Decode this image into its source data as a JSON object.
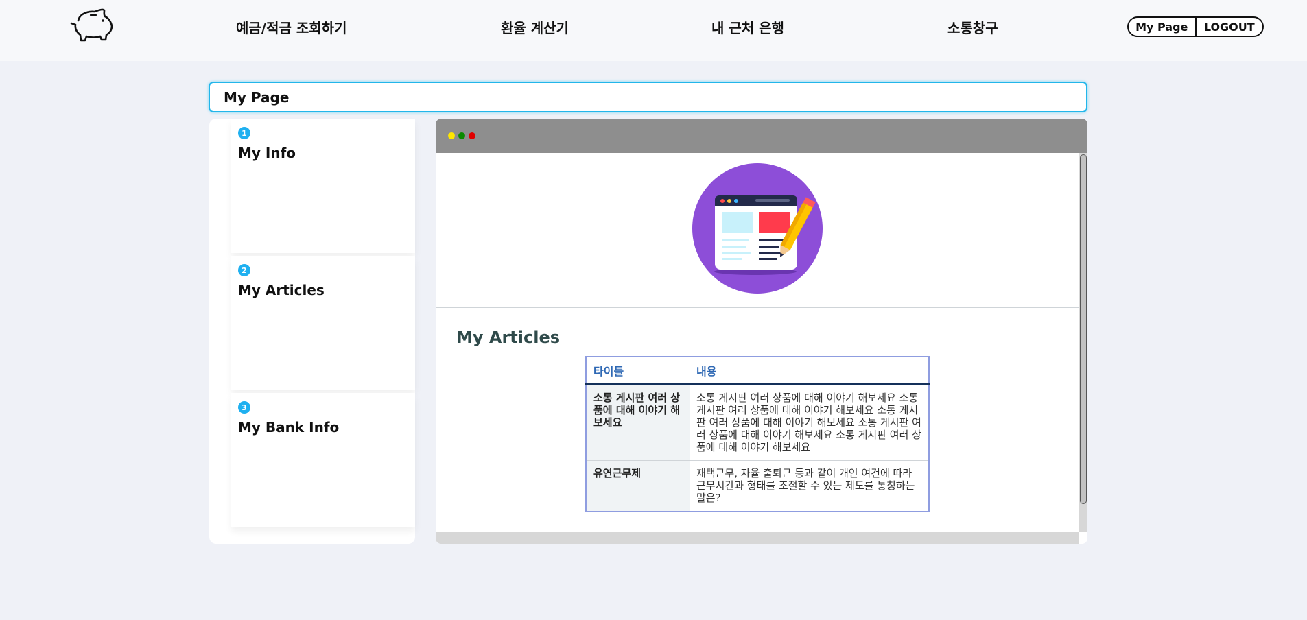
{
  "header": {
    "nav": [
      "예금/적금 조회하기",
      "환율 계산기",
      "내 근처 은행",
      "소통창구"
    ],
    "mypage_label": "My Page",
    "logout_label": "LOGOUT"
  },
  "page": {
    "title": "My Page"
  },
  "sidebar": {
    "items": [
      {
        "num": "1",
        "label": "My Info"
      },
      {
        "num": "2",
        "label": "My Articles"
      },
      {
        "num": "3",
        "label": "My Bank Info"
      }
    ]
  },
  "browser": {
    "dot_colors": [
      "#ffe600",
      "#0a8a00",
      "#e00000"
    ]
  },
  "articles": {
    "title": "My Articles",
    "columns": [
      "타이틀",
      "내용"
    ],
    "rows": [
      {
        "title": "소통 게시판 여러 상품에 대해 이야기 해보세요",
        "body": "소통 게시판 여러 상품에 대해 이야기 해보세요 소통 게시판 여러 상품에 대해 이야기 해보세요 소통 게시판 여러 상품에 대해 이야기 해보세요 소통 게시판 여러 상품에 대해 이야기 해보세요 소통 게시판 여러 상품에 대해 이야기 해보세요"
      },
      {
        "title": "유연근무제",
        "body": "재택근무, 자율 출퇴근 등과 같이 개인 여건에 따라 근무시간과 형태를 조절할 수 있는 제도를 통칭하는 말은?"
      }
    ]
  },
  "colors": {
    "accent": "#22b6ea",
    "illustration_bg": "#8d4ed8"
  },
  "icons": [
    "piggy-bank-icon",
    "article-edit-icon"
  ]
}
